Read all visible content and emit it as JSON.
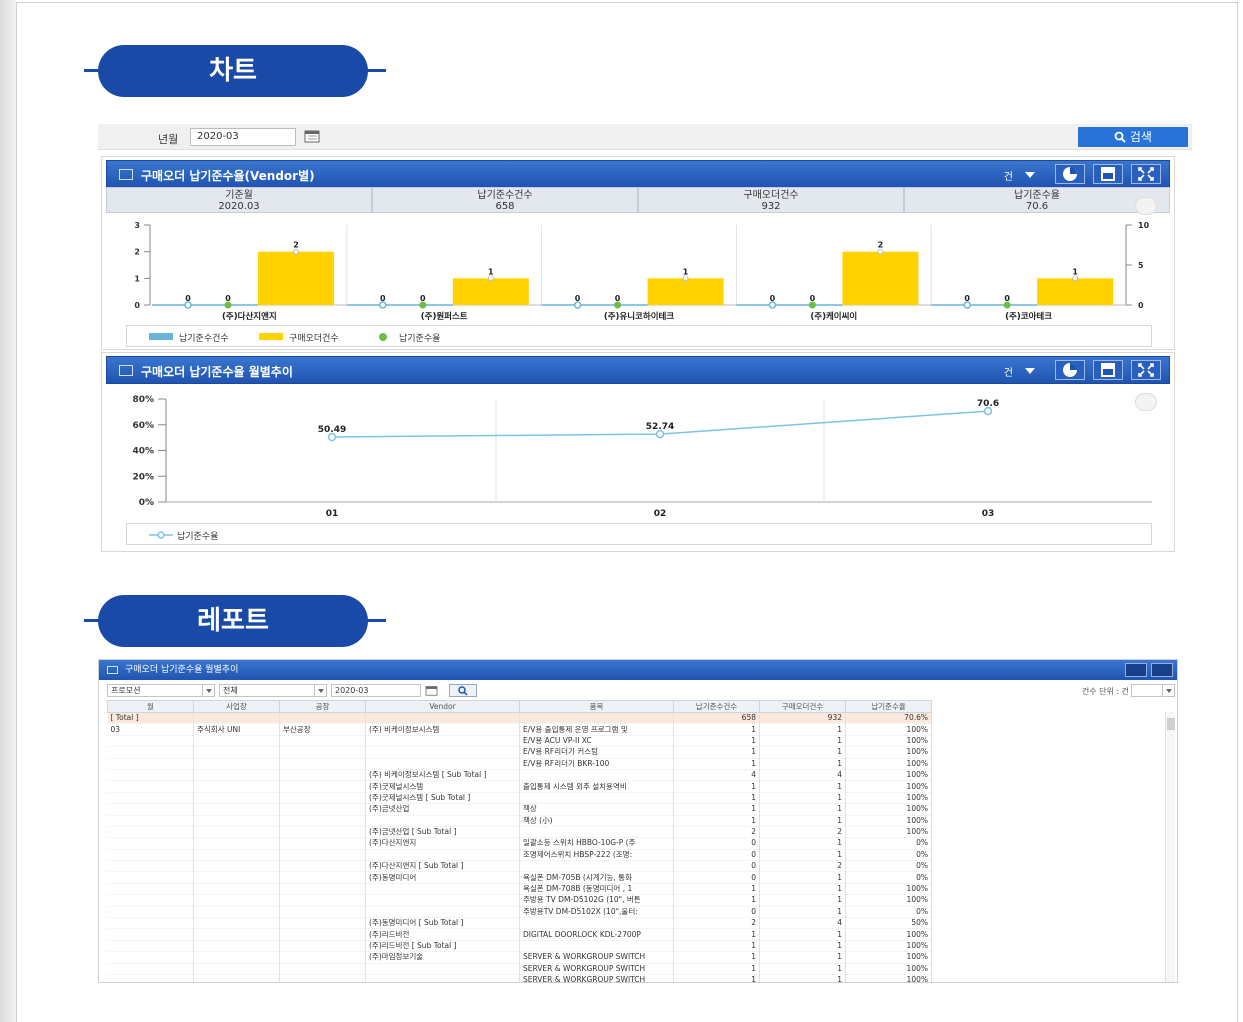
{
  "sections": {
    "chart_title": "차트",
    "report_title": "레포트"
  },
  "search": {
    "label": "년월",
    "value": "2020-03",
    "button": "검색"
  },
  "panel1": {
    "title": "구매오더 납기준수율(Vendor별)",
    "unit": "건",
    "summary": [
      {
        "label": "기준월",
        "value": "2020.03"
      },
      {
        "label": "납기준수건수",
        "value": "658"
      },
      {
        "label": "구매오더건수",
        "value": "932"
      },
      {
        "label": "납기준수율",
        "value": "70.6"
      }
    ],
    "legend": [
      "납기준수건수",
      "구매오더건수",
      "납기준수율"
    ]
  },
  "panel2": {
    "title": "구매오더 납기준수율 월별추이",
    "unit": "건",
    "legend": "납기준수율"
  },
  "chart_data": [
    {
      "type": "bar",
      "categories": [
        "(주)다산지앤지",
        "(주)원퍼스트",
        "(주)유니코하이테크",
        "(주)케이씨이",
        "(주)코아테크"
      ],
      "series": [
        {
          "name": "납기준수건수",
          "values": [
            0,
            0,
            0,
            0,
            0
          ],
          "color": "#6ab4dc"
        },
        {
          "name": "구매오더건수",
          "values": [
            2,
            1,
            1,
            2,
            1
          ],
          "color": "#ffd200"
        },
        {
          "name": "납기준수율",
          "values": [
            0,
            0,
            0,
            0,
            0
          ],
          "color": "#6bbf45"
        }
      ],
      "data_labels_left": [
        0,
        0,
        0,
        0,
        0
      ],
      "data_labels_mid": [
        0,
        0,
        0,
        0,
        0
      ],
      "y_ticks": [
        0,
        1,
        2,
        3
      ],
      "y2_ticks": [
        0,
        5,
        10
      ],
      "ylim": [
        0,
        3
      ],
      "y2lim": [
        0,
        10
      ]
    },
    {
      "type": "line",
      "x": [
        "01",
        "02",
        "03"
      ],
      "series": [
        {
          "name": "납기준수율",
          "values": [
            50.49,
            52.74,
            70.6
          ],
          "color": "#7cc4e6"
        }
      ],
      "data_labels": [
        "50.49",
        "52.74",
        "70.6"
      ],
      "y_ticks": [
        "0%",
        "20%",
        "40%",
        "60%",
        "80%"
      ],
      "ylim": [
        0,
        80
      ]
    }
  ],
  "report": {
    "title": "구매오더 납기준수율 월별추이",
    "filters": {
      "f1": "프로모션",
      "f2": "전체",
      "month": "2020-03",
      "unit_label": "건수 단위 : 건"
    },
    "columns": [
      "월",
      "사업장",
      "공장",
      "Vendor",
      "품목",
      "납기준수건수",
      "구매오더건수",
      "납기준수율"
    ],
    "total_row": [
      "[ Total ]",
      "",
      "",
      "",
      "",
      "658",
      "932",
      "70.6%"
    ],
    "rows": [
      [
        "03",
        "주식회사 UNI",
        "부산공장",
        "(주) 비케이정보시스템",
        "E/V용 출입통제 운영 프로그램 및",
        "1",
        "1",
        "100%"
      ],
      [
        "",
        "",
        "",
        "",
        "E/V용 ACU VP-II XC",
        "1",
        "1",
        "100%"
      ],
      [
        "",
        "",
        "",
        "",
        "E/V용 RF리더기 커스텀",
        "1",
        "1",
        "100%"
      ],
      [
        "",
        "",
        "",
        "",
        "E/V용 RF리더기 BKR-100",
        "1",
        "1",
        "100%"
      ],
      [
        "",
        "",
        "",
        "(주) 비케이정보시스템 [ Sub Total ]",
        "",
        "4",
        "4",
        "100%"
      ],
      [
        "",
        "",
        "",
        "(주)굿제널시스템",
        "출입통제 시스템 외주 설치용역비",
        "1",
        "1",
        "100%"
      ],
      [
        "",
        "",
        "",
        "(주)굿제널시스템 [ Sub Total ]",
        "",
        "1",
        "1",
        "100%"
      ],
      [
        "",
        "",
        "",
        "(주)금넷산업",
        "책상",
        "1",
        "1",
        "100%"
      ],
      [
        "",
        "",
        "",
        "",
        "책상 (小)",
        "1",
        "1",
        "100%"
      ],
      [
        "",
        "",
        "",
        "(주)금넷산업 [ Sub Total ]",
        "",
        "2",
        "2",
        "100%"
      ],
      [
        "",
        "",
        "",
        "(주)다산지앤지",
        "일괄소등 스위치 HBBO-10G-P (주",
        "0",
        "1",
        "0%"
      ],
      [
        "",
        "",
        "",
        "",
        "조명제어스위치 HBSP-222 (조명:",
        "0",
        "1",
        "0%"
      ],
      [
        "",
        "",
        "",
        "(주)다산지앤지 [ Sub Total ]",
        "",
        "0",
        "2",
        "0%"
      ],
      [
        "",
        "",
        "",
        "(주)동명미디어",
        "욕실폰 DM-705B (시계기능, 통화",
        "0",
        "1",
        "0%"
      ],
      [
        "",
        "",
        "",
        "",
        "욕실폰 DM-708B (동명미디어 , 1",
        "1",
        "1",
        "100%"
      ],
      [
        "",
        "",
        "",
        "",
        "주방용 TV DM-D5102G (10\", 버튼",
        "1",
        "1",
        "100%"
      ],
      [
        "",
        "",
        "",
        "",
        "주방용TV DM-D5102X (10\",울터:",
        "0",
        "1",
        "0%"
      ],
      [
        "",
        "",
        "",
        "(주)동명미디어 [ Sub Total ]",
        "",
        "2",
        "4",
        "50%"
      ],
      [
        "",
        "",
        "",
        "(주)리드비전",
        "DIGITAL DOORLOCK KDL-2700P",
        "1",
        "1",
        "100%"
      ],
      [
        "",
        "",
        "",
        "(주)리드비전 [ Sub Total ]",
        "",
        "1",
        "1",
        "100%"
      ],
      [
        "",
        "",
        "",
        "(주)마임정보기술",
        "SERVER & WORKGROUP SWITCH",
        "1",
        "1",
        "100%"
      ],
      [
        "",
        "",
        "",
        "",
        "SERVER & WORKGROUP SWITCH",
        "1",
        "1",
        "100%"
      ],
      [
        "",
        "",
        "",
        "",
        "SERVER & WORKGROUP SWITCH",
        "1",
        "1",
        "100%"
      ]
    ]
  }
}
